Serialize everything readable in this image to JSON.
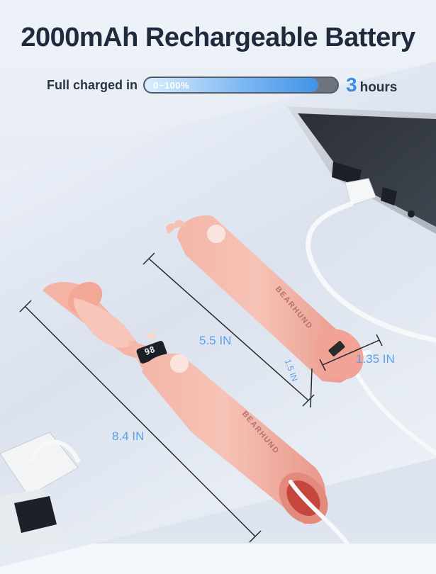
{
  "headline": "2000mAh Rechargeable Battery",
  "charge": {
    "label": "Full charged in",
    "range": "0~100%",
    "time_value": "3",
    "time_unit": "hours"
  },
  "dimensions": {
    "fan_length": "8.4 IN",
    "battery_length": "5.5 IN",
    "battery_diameter": "1.35 IN",
    "port_height": "1.5 IN"
  },
  "brand": "BEARHUND",
  "fan_screen": "98"
}
